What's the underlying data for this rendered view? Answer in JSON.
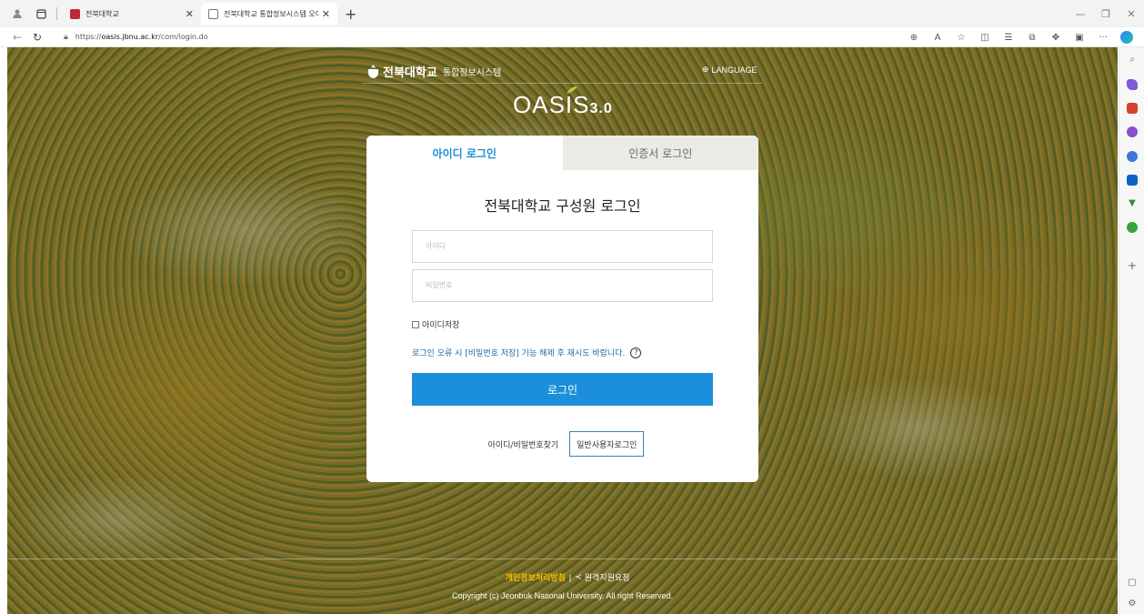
{
  "browser": {
    "tabs": [
      {
        "title": "전북대학교",
        "favicon_color": "#c0263a"
      },
      {
        "title": "전북대학교 통합정보시스템 오아",
        "favicon_color": "#ffffff"
      }
    ],
    "url_prefix": "https://",
    "url_host": "oasis.jbnu.ac.kr",
    "url_path": "/com/login.do"
  },
  "header": {
    "university": "전북대학교",
    "system": "통합정보시스템",
    "language": "LANGUAGE"
  },
  "logo": {
    "name": "OASIS",
    "version": "3.0"
  },
  "login": {
    "tabs": [
      {
        "label": "아이디 로그인",
        "active": true
      },
      {
        "label": "인증서 로그인",
        "active": false
      }
    ],
    "title": "전북대학교 구성원 로그인",
    "id_placeholder": "아이디",
    "pw_placeholder": "비밀번호",
    "save_id_label": "아이디저장",
    "notice": "로그인 오류 시 [비밀번호 저장] 기능 해제 후 재시도 바랍니다.",
    "login_button": "로그인",
    "find_button": "아이디/비밀번호찾기",
    "general_button": "일반사용자로그인"
  },
  "footer": {
    "privacy": "개인정보처리방침",
    "separator": "|",
    "remote": "원격지원요청",
    "copyright": "Copyright (c) Jeonbuk National University. All right Reserved."
  },
  "colors": {
    "accent": "#1c8fdb",
    "privacy": "#f2c200"
  }
}
